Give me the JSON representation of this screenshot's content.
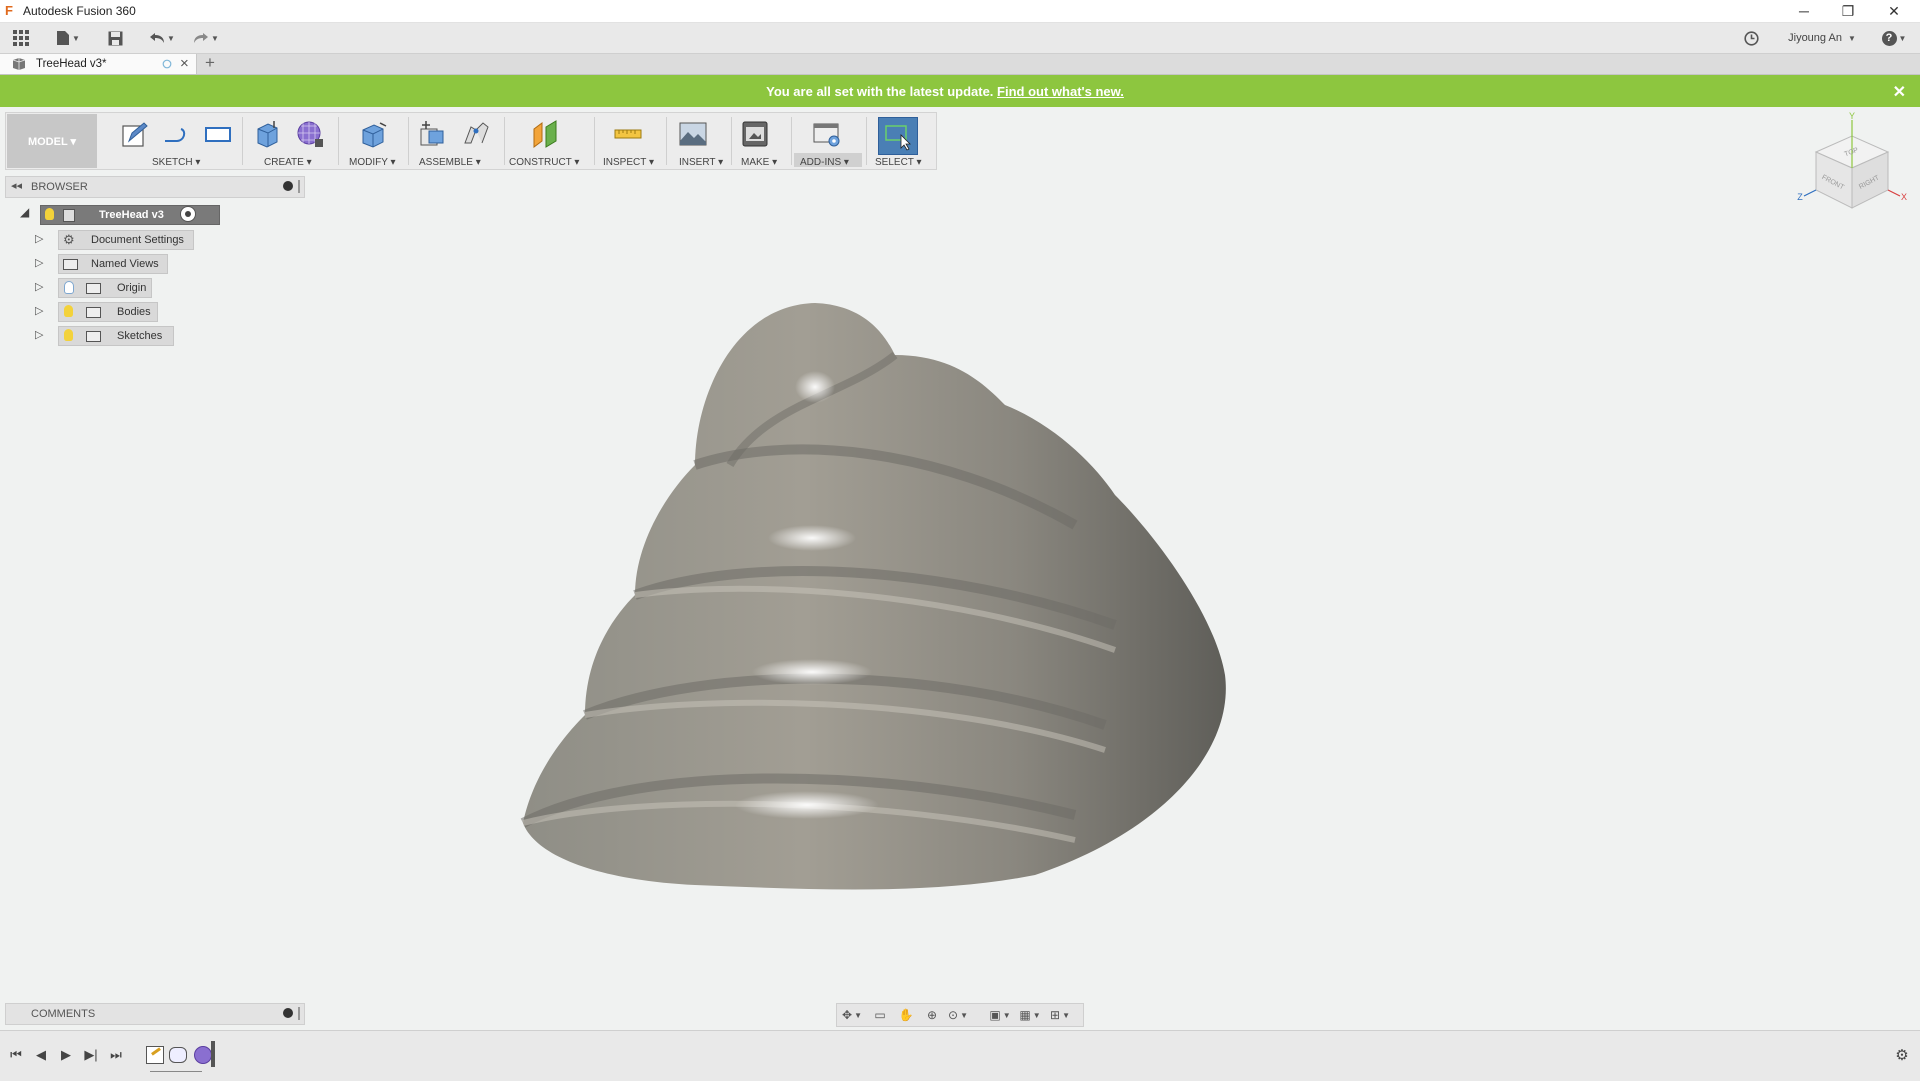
{
  "window": {
    "title": "Autodesk Fusion 360",
    "logo_letter": "F",
    "minimize": "─",
    "restore": "❐",
    "close": "✕"
  },
  "quick_access": {
    "user_name": "Jiyoung An",
    "help_glyph": "?"
  },
  "document_tab": {
    "label": "TreeHead v3*",
    "new_tab": "+",
    "close": "×"
  },
  "banner": {
    "message": "You are all set with the latest update.",
    "link": "Find out what's new.",
    "close": "✕"
  },
  "toolbar": {
    "workspace": "MODEL ▾",
    "groups": {
      "sketch": "SKETCH ▾",
      "create": "CREATE ▾",
      "modify": "MODIFY ▾",
      "assemble": "ASSEMBLE ▾",
      "construct": "CONSTRUCT ▾",
      "inspect": "INSPECT ▾",
      "insert": "INSERT ▾",
      "make": "MAKE ▾",
      "addins": "ADD-INS ▾",
      "select": "SELECT ▾"
    }
  },
  "browser": {
    "title": "BROWSER",
    "root": "TreeHead v3",
    "items": [
      {
        "label": "Document Settings",
        "icon": "gear-icon"
      },
      {
        "label": "Named Views",
        "icon": "folder-icon"
      },
      {
        "label": "Origin",
        "icon": "folder-icon"
      },
      {
        "label": "Bodies",
        "icon": "folder-icon"
      },
      {
        "label": "Sketches",
        "icon": "folder-icon"
      }
    ]
  },
  "comments": {
    "title": "COMMENTS"
  },
  "viewcube": {
    "top": "TOP",
    "front": "FRONT",
    "right": "RIGHT",
    "axis_y": "Y",
    "axis_z": "Z",
    "axis_x": "X"
  },
  "colors": {
    "banner": "#8dc63f",
    "select_active": "#4a7fb5",
    "canvas": "#f0f2f1"
  }
}
